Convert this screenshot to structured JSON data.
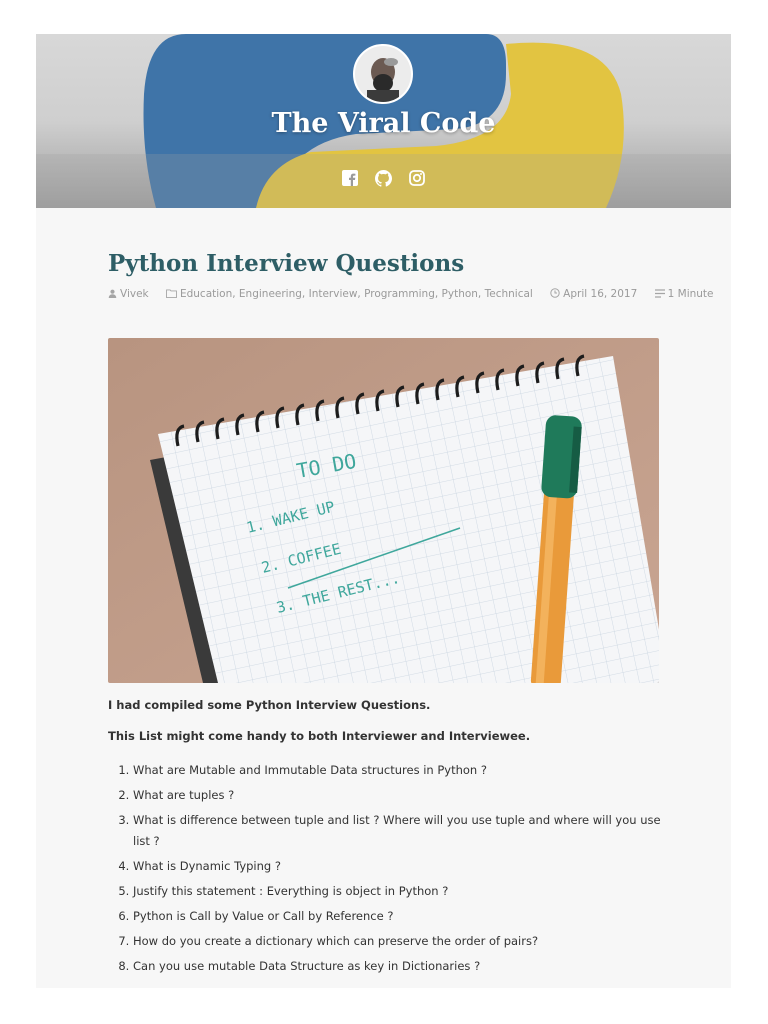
{
  "site": {
    "title": "The Viral Code",
    "social_icons": [
      "facebook-icon",
      "github-icon",
      "instagram-icon"
    ]
  },
  "post": {
    "title": "Python Interview Questions",
    "author": "Vivek",
    "categories": [
      "Education",
      "Engineering",
      "Interview",
      "Programming",
      "Python",
      "Technical"
    ],
    "categories_text": "Education, Engineering, Interview, Programming, Python, Technical",
    "date": "April 16, 2017",
    "read_time": "1 Minute"
  },
  "image": {
    "heading": "TO DO",
    "lines": [
      "1. WAKE UP",
      "2. COFFEE",
      "3. THE REST..."
    ]
  },
  "content": {
    "intro": "I had compiled some Python Interview Questions.",
    "subintro": "This List might come handy to both Interviewer and Interviewee.",
    "questions": [
      "What are Mutable and Immutable Data structures in Python ?",
      "What are tuples ?",
      "What is difference between tuple and list ? Where will you use tuple and where will you use list ?",
      "What is Dynamic Typing ?",
      "Justify this statement : Everything is object in Python ?",
      "Python is Call by Value or Call by Reference ?",
      "How do you create a dictionary which can preserve the order of pairs?",
      "Can you use mutable Data Structure as key in Dictionaries ?"
    ]
  },
  "colors": {
    "title_teal": "#2e5e66",
    "python_blue": "#3d73a6",
    "python_yellow": "#e3c53f",
    "page_bg": "#f7f7f7"
  }
}
